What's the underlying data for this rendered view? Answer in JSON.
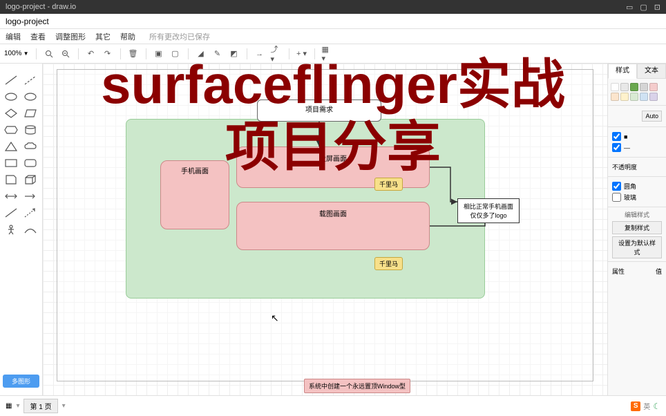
{
  "titlebar": {
    "title": "logo-project - draw.io"
  },
  "filebar": {
    "filename": "logo-project"
  },
  "menubar": {
    "items": [
      "编辑",
      "查看",
      "调整图形",
      "其它",
      "帮助"
    ],
    "saved_text": "所有更改均已保存"
  },
  "toolbar": {
    "zoom": "100%"
  },
  "shapes": {
    "more_btn": "多图形"
  },
  "rightpanel": {
    "tabs": {
      "style": "样式",
      "text": "文本"
    },
    "auto": "Auto",
    "opacity_label": "不透明度",
    "rounded": "圆角",
    "glass": "玻璃",
    "copy_style": "编辑样式",
    "copy_style2": "复制样式",
    "set_default": "设置为默认样式",
    "props": "属性",
    "val": "值",
    "colors": [
      "#ffffff",
      "#e8e8e8",
      "#6aa84f",
      "#f4cccc",
      "#fce5cd",
      "#fff2cc",
      "#d9ead3",
      "#cfe2f3",
      "#d9d2e9",
      "#ead1dc"
    ]
  },
  "diagram": {
    "node_req": "项目需求",
    "node_proj": "投屏画面",
    "node_cut": "载图画面",
    "node_phone": "手机画面",
    "node_tag": "千里马",
    "node_result": "相比正常手机画面仅仅多了logo"
  },
  "note_bottom": "系统中创建一个永远置顶Window型",
  "bottombar": {
    "page_tab": "第 1 页",
    "ime_s": "S",
    "ime_lbl": "英"
  },
  "overlay": {
    "line1": "surfaceflinger实战",
    "line2": "项目分享"
  }
}
